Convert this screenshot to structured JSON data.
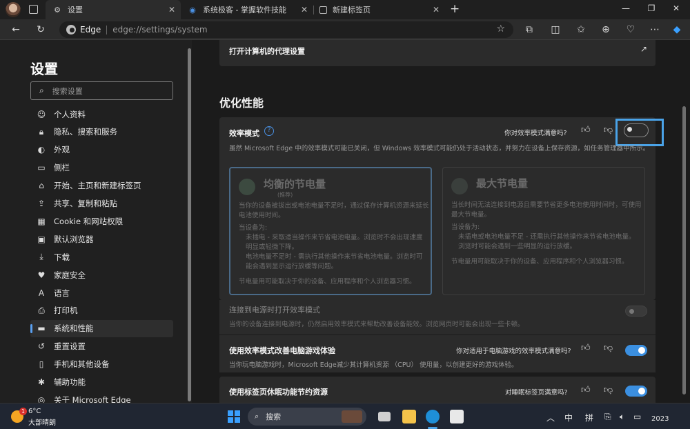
{
  "tabs": [
    {
      "label": "设置",
      "icon": "gear-icon"
    },
    {
      "label": "系统极客 - 掌握软件技能",
      "icon": "site-globe-icon"
    },
    {
      "label": "新建标签页",
      "icon": "new-tab-page-icon"
    }
  ],
  "address": {
    "brand": "Edge",
    "url": "edge://settings/system"
  },
  "sidebar": {
    "title": "设置",
    "search_placeholder": "搜索设置",
    "items": [
      {
        "label": "个人资料",
        "icon": "profile-icon"
      },
      {
        "label": "隐私、搜索和服务",
        "icon": "lock-icon"
      },
      {
        "label": "外观",
        "icon": "appearance-icon"
      },
      {
        "label": "侧栏",
        "icon": "sidebar-icon"
      },
      {
        "label": "开始、主页和新建标签页",
        "icon": "home-icon"
      },
      {
        "label": "共享、复制和粘贴",
        "icon": "share-icon"
      },
      {
        "label": "Cookie 和网站权限",
        "icon": "site-permissions-icon"
      },
      {
        "label": "默认浏览器",
        "icon": "default-browser-icon"
      },
      {
        "label": "下载",
        "icon": "download-icon"
      },
      {
        "label": "家庭安全",
        "icon": "family-icon"
      },
      {
        "label": "语言",
        "icon": "language-icon"
      },
      {
        "label": "打印机",
        "icon": "printer-icon"
      },
      {
        "label": "系统和性能",
        "icon": "system-icon",
        "selected": true
      },
      {
        "label": "重置设置",
        "icon": "reset-icon"
      },
      {
        "label": "手机和其他设备",
        "icon": "phone-icon"
      },
      {
        "label": "辅助功能",
        "icon": "accessibility-icon"
      },
      {
        "label": "关于 Microsoft Edge",
        "icon": "edge-logo-icon"
      }
    ]
  },
  "main": {
    "proxy_label": "打开计算机的代理设置",
    "section_title": "优化性能",
    "efficiency": {
      "title": "效率模式",
      "feedback_question": "你对效率模式满意吗?",
      "toggle_on": false,
      "description": "虽然 Microsoft Edge 中的效率模式可能已关闭，但 Windows 效率模式可能仍处于活动状态，并努力在设备上保存资源，如任务管理器中所示。",
      "balanced": {
        "title": "均衡的节电量",
        "tag": "(推荐)",
        "desc": "当你的设备被拔出或电池电量不足时，通过保存计算机资源来延长电池使用时间。",
        "when_label": "当设备为:",
        "bullets": [
          "未插电 - 采取适当操作来节省电池电量。浏览时不会出现速度明显或轻微下降。",
          "电池电量不足时 - 需执行其他操作来节省电池电量。浏览时可能会遇到显示运行放缓等问题。"
        ],
        "note": "节电量用可能取决于你的设备、应用程序和个人浏览器习惯。"
      },
      "maximum": {
        "title": "最大节电量",
        "desc": "当长时间无法连接到电源且需要节省更多电池使用时间时，可使用最大节电量。",
        "when_label": "当设备为:",
        "bullets": [
          "未插电或电池电量不足 - 还需执行其他操作来节省电池电量。浏览时可能会遇到一些明显的运行放缓。"
        ],
        "note": "节电量用可能取决于你的设备、应用程序和个人浏览器习惯。"
      }
    },
    "power_connect": {
      "title": "连接到电源时打开效率模式",
      "desc": "当你的设备连接到电源时，仍然启用效率模式来帮助改善设备能效。浏览网页时可能会出现一些卡顿。",
      "toggle_on": false
    },
    "gaming": {
      "title": "使用效率模式改善电脑游戏体验",
      "feedback_question": "你对适用于电脑游戏的效率模式满意吗?",
      "desc": "当你玩电脑游戏时，Microsoft Edge减少其计算机资源 （CPU） 使用量，以创建更好的游戏体验。",
      "toggle_on": true
    },
    "sleeping_tabs": {
      "title": "使用标签页休眠功能节约资源",
      "feedback_question": "对睡眠标签页满意吗?",
      "toggle_on": true
    }
  },
  "taskbar": {
    "weather_temp": "6°C",
    "weather_desc": "大部晴朗",
    "weather_badge": "1",
    "search_label": "搜索",
    "ime_lang": "中",
    "ime_mode": "拼",
    "year": "2023"
  },
  "colors": {
    "accent": "#3b8fe0",
    "highlight_box": "#4aa3e8",
    "balanced_border": "#4a6a88"
  }
}
